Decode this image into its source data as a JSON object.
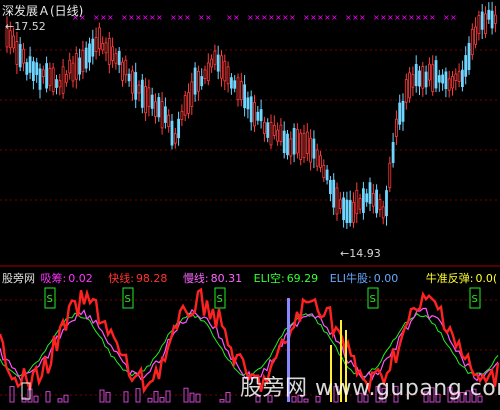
{
  "header": {
    "title": "深发展Ａ(日线)",
    "high_label": "17.52",
    "low_label": "14.93"
  },
  "indicator": {
    "name": "股旁网",
    "items": [
      {
        "label": "吸筹:",
        "value": "0.02",
        "color": "#ff33ff"
      },
      {
        "label": "快线:",
        "value": "98.28",
        "color": "#ff3333"
      },
      {
        "label": "慢线:",
        "value": "80.31",
        "color": "#ff66ff"
      },
      {
        "label": "ELI空:",
        "value": "69.29",
        "color": "#33ff33"
      },
      {
        "label": "ELI牛股:",
        "value": "0.00",
        "color": "#66aaff"
      },
      {
        "label": "牛准反弹:",
        "value": "0.0(",
        "color": "#ffff33"
      }
    ],
    "signal_text": "S"
  },
  "watermark": "股旁网 www.gupang.com",
  "colors": {
    "up": "#ff3b3b",
    "down": "#6fd6ff",
    "grid": "#7a0000",
    "marker": "#ff00ff",
    "fast_line": "#ff2222",
    "slow_line": "#ff55ff",
    "green_line": "#22ee22"
  }
}
